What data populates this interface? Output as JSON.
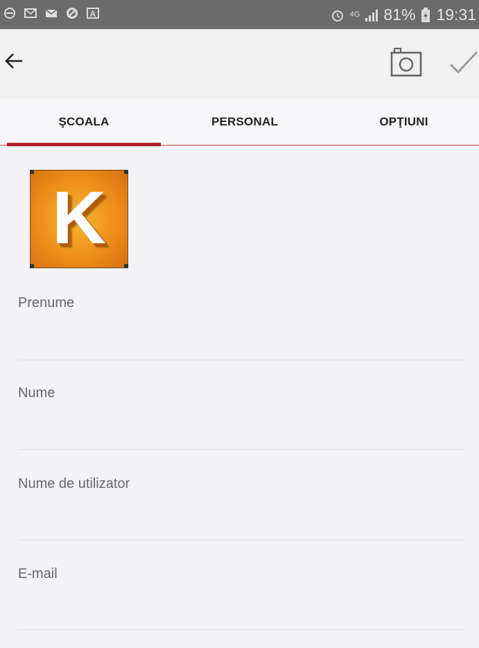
{
  "status_bar": {
    "network_type": "4G",
    "battery": "81%",
    "time": "19:31"
  },
  "toolbar": {
    "back_icon": "arrow-left-icon",
    "camera_icon": "camera-icon",
    "confirm_icon": "check-icon"
  },
  "tabs": [
    {
      "label": "ŞCOALA",
      "active": true
    },
    {
      "label": "PERSONAL",
      "active": false
    },
    {
      "label": "OPŢIUNI",
      "active": false
    }
  ],
  "colors": {
    "accent": "#b0212e",
    "logo_orange": "#ef8e1b",
    "status_bar": "#6b6b6b"
  },
  "profile": {
    "logo_letter": "K"
  },
  "fields": {
    "first_name": {
      "label": "Prenume",
      "value": ""
    },
    "last_name": {
      "label": "Nume",
      "value": ""
    },
    "username": {
      "label": "Nume de utilizator",
      "value": ""
    },
    "email": {
      "label": "E-mail",
      "value": ""
    }
  }
}
